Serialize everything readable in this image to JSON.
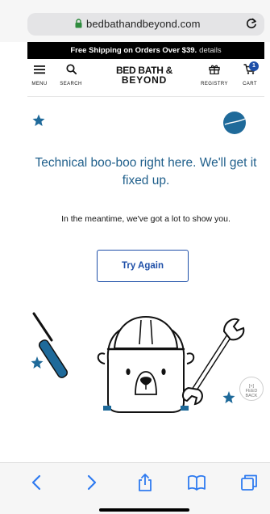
{
  "browser": {
    "url": "bedbathandbeyond.com"
  },
  "promo": {
    "text": "Free Shipping on Orders Over $39.",
    "link": "details"
  },
  "header": {
    "menu_label": "MENU",
    "search_label": "SEARCH",
    "logo_line1": "BED BATH &",
    "logo_line2": "BEYOND",
    "registry_label": "REGISTRY",
    "cart_label": "CART",
    "cart_count": "1"
  },
  "main": {
    "headline": "Technical boo-boo right here. We'll get it fixed up.",
    "subtext": "In the meantime, we've got a lot to show you.",
    "button_label": "Try Again"
  },
  "feedback": {
    "line1": "[+]",
    "line2": "FEED",
    "line3": "BACK"
  },
  "colors": {
    "accent": "#1e4fa8",
    "headline": "#1f5f8b",
    "star": "#1f6a9a"
  }
}
